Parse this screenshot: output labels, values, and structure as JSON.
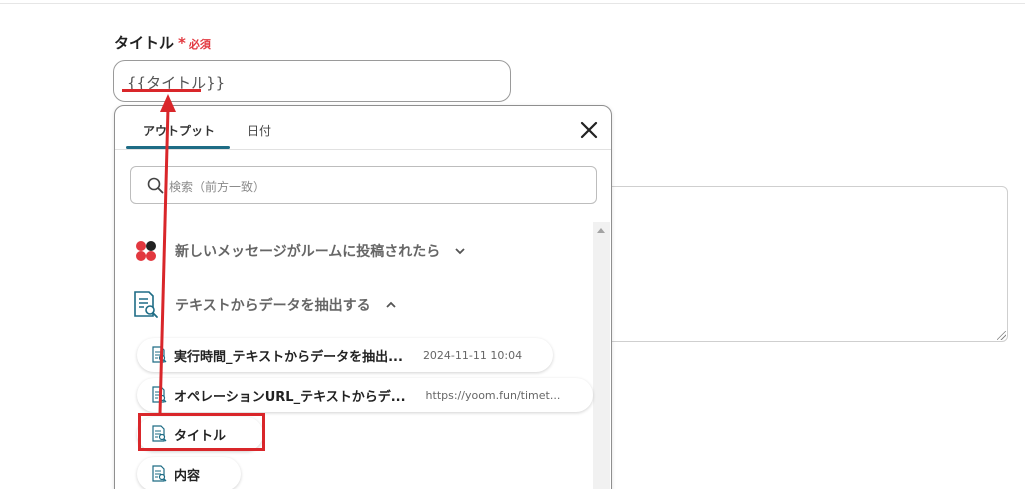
{
  "form": {
    "field_label": "タイトル",
    "required_mark": "*",
    "required_text": "必須",
    "title_input_value": "{{タイトル}}"
  },
  "popup": {
    "tabs": [
      {
        "label": "アウトプット",
        "active": true
      },
      {
        "label": "日付",
        "active": false
      }
    ],
    "search_placeholder": "検索（前方一致）",
    "groups": [
      {
        "label": "新しいメッセージがルームに投稿されたら",
        "icon": "chatwork-icon",
        "expanded": false
      },
      {
        "label": "テキストからデータを抽出する",
        "icon": "document-search-icon",
        "expanded": true
      }
    ],
    "items": [
      {
        "label": "実行時間_テキストからデータを抽出...",
        "value": "2024-11-11 10:04"
      },
      {
        "label": "オペレーションURL_テキストからデ...",
        "value": "https://yoom.fun/timet..."
      },
      {
        "label": "タイトル",
        "value": ""
      },
      {
        "label": "内容",
        "value": ""
      }
    ]
  },
  "colors": {
    "accent_tab": "#1e6c85",
    "annotation_red": "#d9262a",
    "required_red": "#e2383f"
  }
}
